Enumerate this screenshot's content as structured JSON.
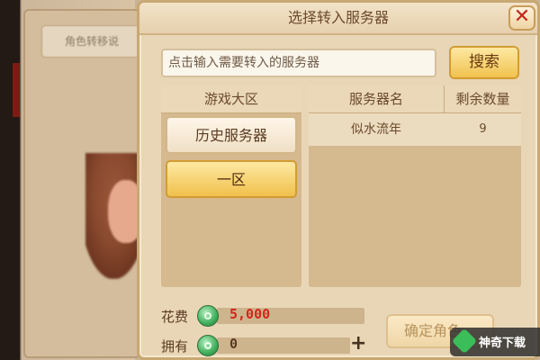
{
  "dialog": {
    "title": "选择转入服务器",
    "close_label": "✕"
  },
  "background": {
    "tab_label": "角色转移说"
  },
  "search": {
    "placeholder": "点击输入需要转入的服务器",
    "button_label": "搜索"
  },
  "regions": {
    "header": "游戏大区",
    "items": [
      {
        "label": "历史服务器",
        "selected": false
      },
      {
        "label": "一区",
        "selected": true
      }
    ]
  },
  "servers": {
    "headers": {
      "name": "服务器名",
      "count": "剩余数量"
    },
    "rows": [
      {
        "name": "似水流年",
        "count": "9"
      }
    ]
  },
  "cost": {
    "label": "花费",
    "value": "5,000",
    "icon": "jade-coin-icon"
  },
  "owned": {
    "label": "拥有",
    "value": "0",
    "icon": "jade-coin-icon",
    "add_label": "+"
  },
  "confirm": {
    "label": "确定角色"
  },
  "watermark": {
    "text": "神奇下载"
  },
  "colors": {
    "panel": "#e9d6b6",
    "accent_button": "#f1c24f",
    "cost_value": "#d2261a",
    "close_x": "#c0271b"
  }
}
